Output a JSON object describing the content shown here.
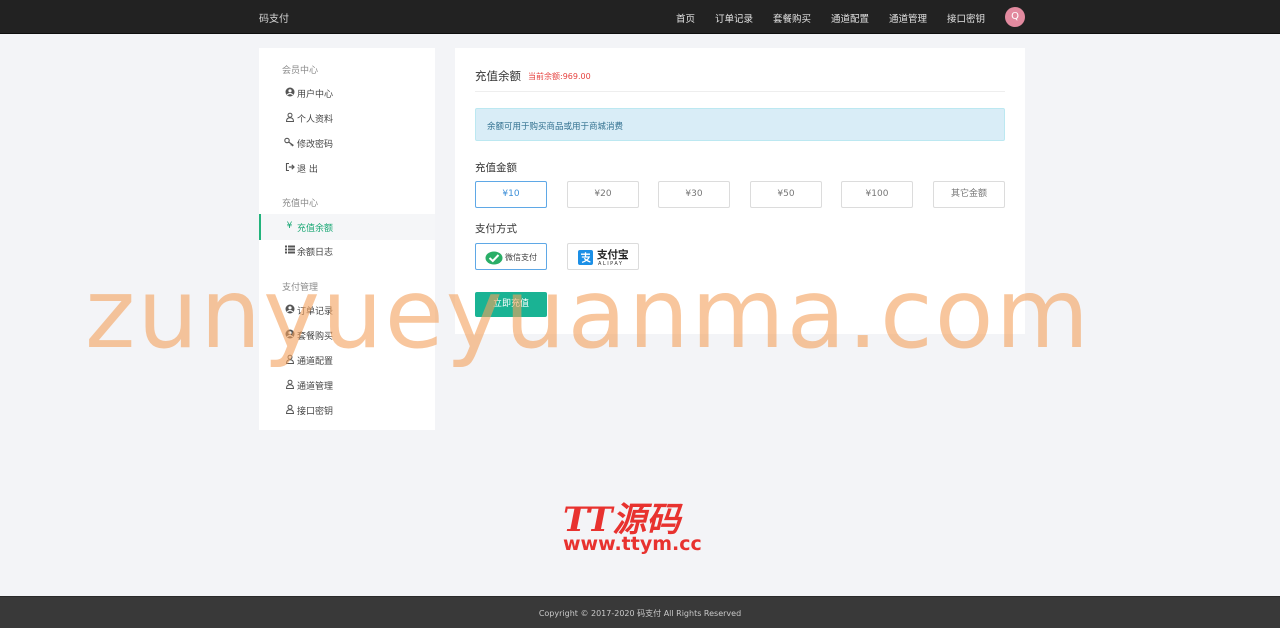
{
  "header": {
    "brand": "码支付",
    "nav": [
      {
        "label": "首页"
      },
      {
        "label": "订单记录"
      },
      {
        "label": "套餐购买"
      },
      {
        "label": "通道配置"
      },
      {
        "label": "通道管理"
      },
      {
        "label": "接口密钥"
      }
    ],
    "avatar_letter": "Q"
  },
  "sidebar": {
    "groups": [
      {
        "title": "会员中心",
        "items": [
          {
            "label": "用户中心",
            "icon": "user-circle-icon"
          },
          {
            "label": "个人资料",
            "icon": "user-outline-icon"
          },
          {
            "label": "修改密码",
            "icon": "key-icon"
          },
          {
            "label": "退 出",
            "icon": "sign-out-icon"
          }
        ]
      },
      {
        "title": "充值中心",
        "items": [
          {
            "label": "充值余额",
            "icon": "yen-icon",
            "active": true
          },
          {
            "label": "余额日志",
            "icon": "list-icon"
          }
        ]
      },
      {
        "title": "支付管理",
        "items": [
          {
            "label": "订单记录",
            "icon": "user-circle-icon"
          },
          {
            "label": "套餐购买",
            "icon": "user-circle-icon"
          },
          {
            "label": "通道配置",
            "icon": "user-outline-icon"
          },
          {
            "label": "通道管理",
            "icon": "user-outline-icon"
          },
          {
            "label": "接口密钥",
            "icon": "user-outline-icon"
          }
        ]
      }
    ]
  },
  "main": {
    "title": "充值余额",
    "balance_text": "当前余额:969.00",
    "notice": "余额可用于购买商品或用于商城消费",
    "amount_label": "充值金额",
    "amounts": [
      {
        "label": "¥10",
        "selected": true
      },
      {
        "label": "¥20"
      },
      {
        "label": "¥30"
      },
      {
        "label": "¥50"
      },
      {
        "label": "¥100"
      },
      {
        "label": "其它金额"
      }
    ],
    "payment_label": "支付方式",
    "payments": [
      {
        "label": "微信支付",
        "icon": "wechat-icon",
        "selected": true
      },
      {
        "label": "支付宝",
        "sublabel": "ALIPAY",
        "icon": "alipay-icon"
      }
    ],
    "submit_label": "立即充值"
  },
  "watermark": {
    "text": "zunyueyuanma.com",
    "logo_cn": "TT源码",
    "logo_url": "www.ttym.cc"
  },
  "footer": {
    "copyright": "Copyright © 2017-2020 码支付 All Rights Reserved"
  },
  "colors": {
    "topbar": "#222222",
    "accent_green": "#1ab394",
    "selected_blue": "#5fa8e6",
    "balance_red": "#e64340",
    "alert_bg": "#d9edf7"
  }
}
